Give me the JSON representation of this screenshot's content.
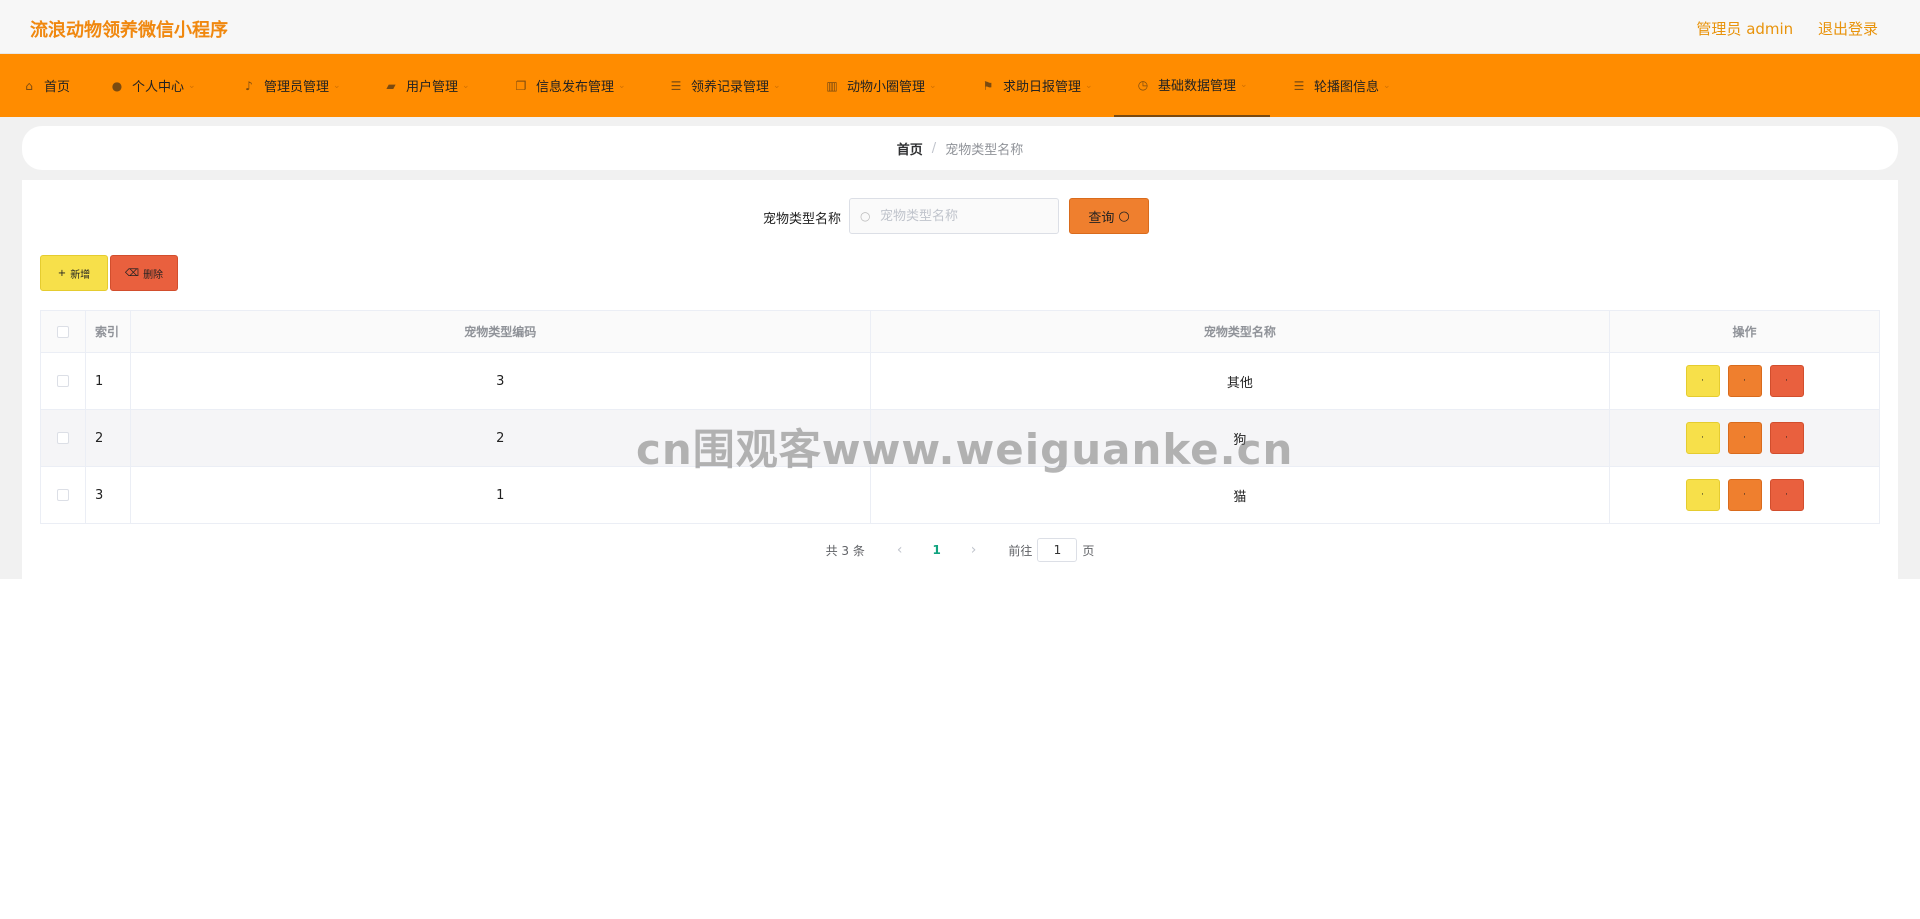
{
  "header": {
    "app_title": "流浪动物领养微信小程序",
    "admin_label": "管理员 admin",
    "logout_label": "退出登录"
  },
  "nav": {
    "items": [
      {
        "label": "首页",
        "icon": "home-icon"
      },
      {
        "label": "个人中心",
        "icon": "user-icon"
      },
      {
        "label": "管理员管理",
        "icon": "mic-icon"
      },
      {
        "label": "用户管理",
        "icon": "chat-icon"
      },
      {
        "label": "信息发布管理",
        "icon": "copy-icon"
      },
      {
        "label": "领养记录管理",
        "icon": "list-icon"
      },
      {
        "label": "动物小圈管理",
        "icon": "trash-icon"
      },
      {
        "label": "求助日报管理",
        "icon": "flag-icon"
      },
      {
        "label": "基础数据管理",
        "icon": "clock-icon"
      },
      {
        "label": "轮播图信息",
        "icon": "list-icon"
      }
    ],
    "active_index": 8
  },
  "breadcrumb": {
    "home": "首页",
    "separator": "/",
    "current": "宠物类型名称"
  },
  "search": {
    "label": "宠物类型名称",
    "placeholder": "宠物类型名称",
    "value": "",
    "button_label": "查询"
  },
  "actions": {
    "add_label": "新增",
    "delete_label": "删除"
  },
  "table": {
    "columns": [
      "",
      "索引",
      "宠物类型编码",
      "宠物类型名称",
      "操作"
    ],
    "rows": [
      {
        "index": "1",
        "code": "3",
        "name": "其他"
      },
      {
        "index": "2",
        "code": "2",
        "name": "狗"
      },
      {
        "index": "3",
        "code": "1",
        "name": "猫"
      }
    ],
    "row_action_labels": [
      "·",
      "·",
      "·"
    ]
  },
  "pagination": {
    "total_text": "共 3 条",
    "current_page": "1",
    "goto_prefix": "前往",
    "goto_value": "1",
    "goto_suffix": "页"
  },
  "watermark": "cn围观客www.weiguanke.cn",
  "colors": {
    "accent": "#ff8c00",
    "title": "#f0880f",
    "view_button": "#f7e04a",
    "edit_button": "#ef7f2e",
    "delete_button": "#e9603e"
  }
}
